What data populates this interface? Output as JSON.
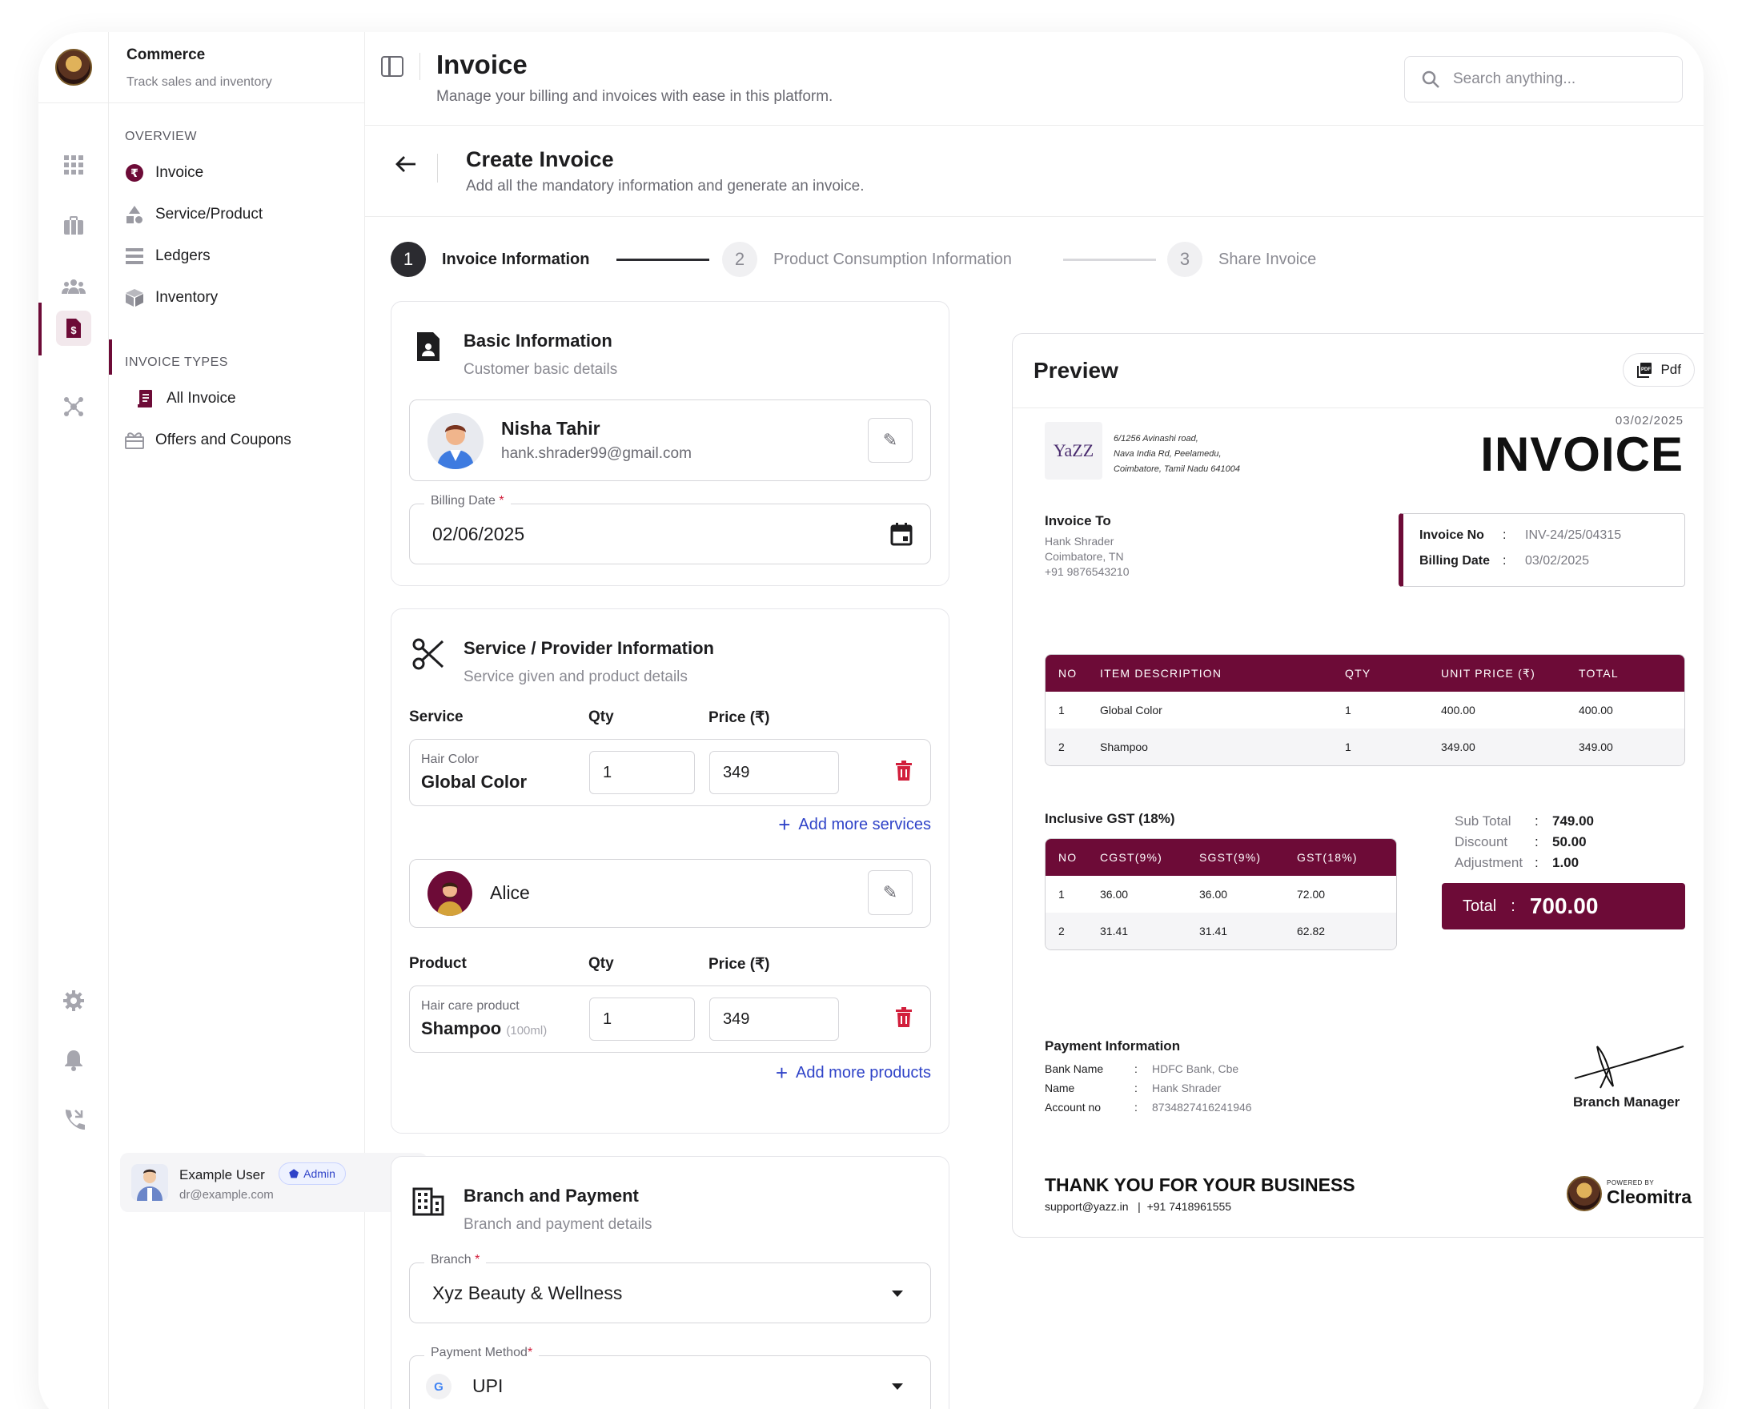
{
  "app": {
    "name": "Commerce",
    "tagline": "Track sales and inventory"
  },
  "rail": {
    "icons": [
      "dashboard-icon",
      "briefcase-icon",
      "users-icon",
      "invoice-icon",
      "network-icon",
      "settings-icon",
      "bell-icon",
      "phone-icon"
    ]
  },
  "sidebar": {
    "overview_label": "OVERVIEW",
    "overview_items": [
      {
        "label": "Invoice",
        "icon": "rupee-icon"
      },
      {
        "label": "Service/Product",
        "icon": "shapes-icon"
      },
      {
        "label": "Ledgers",
        "icon": "list-icon"
      },
      {
        "label": "Inventory",
        "icon": "box-icon"
      }
    ],
    "types_label": "INVOICE TYPES",
    "types_items": [
      {
        "label": "All Invoice",
        "icon": "receipt-icon"
      },
      {
        "label": "Offers and Coupons",
        "icon": "gift-icon"
      }
    ]
  },
  "user": {
    "name": "Example User",
    "email": "dr@example.com",
    "role": "Admin"
  },
  "header": {
    "title": "Invoice",
    "subtitle": "Manage your billing and invoices with ease in this platform.",
    "search_placeholder": "Search anything..."
  },
  "create": {
    "title": "Create Invoice",
    "subtitle": "Add all the mandatory information and generate an invoice."
  },
  "steps": [
    {
      "num": "1",
      "label": "Invoice Information",
      "active": true
    },
    {
      "num": "2",
      "label": "Product Consumption Information",
      "active": false
    },
    {
      "num": "3",
      "label": "Share Invoice",
      "active": false
    }
  ],
  "basic": {
    "title": "Basic Information",
    "subtitle": "Customer basic details",
    "customer_name": "Nisha Tahir",
    "customer_email": "hank.shrader99@gmail.com",
    "billing_date_label": "Billing Date",
    "billing_date": "02/06/2025"
  },
  "service": {
    "title": "Service / Provider Information",
    "subtitle": "Service given and product details",
    "col_service": "Service",
    "col_qty": "Qty",
    "col_price": "Price (₹)",
    "service_category": "Hair Color",
    "service_name": "Global Color",
    "service_qty": "1",
    "service_price": "349",
    "add_services": "Add more services",
    "provider_name": "Alice",
    "col_product": "Product",
    "product_category": "Hair care product",
    "product_name": "Shampoo",
    "product_size": "(100ml)",
    "product_qty": "1",
    "product_price": "349",
    "add_products": "Add more products"
  },
  "branch": {
    "title": "Branch and Payment",
    "subtitle": "Branch and payment details",
    "branch_label": "Branch",
    "branch_value": "Xyz Beauty & Wellness",
    "payment_label": "Payment Method",
    "payment_value": "UPI"
  },
  "preview": {
    "title": "Preview",
    "pdf_label": "Pdf",
    "logo_text": "YaZZ",
    "address": [
      "6/1256 Avinashi road,",
      "Nava India Rd, Peelamedu,",
      "Coimbatore, Tamil Nadu 641004"
    ],
    "date": "03/02/2025",
    "heading": "INVOICE",
    "invoice_to_label": "Invoice To",
    "invoice_to": [
      "Hank Shrader",
      "Coimbatore, TN",
      "+91 9876543210"
    ],
    "invoice_no_label": "Invoice No",
    "invoice_no": "INV-24/25/04315",
    "billing_date_label": "Billing Date",
    "billing_date": "03/02/2025",
    "items_header": [
      "NO",
      "ITEM DESCRIPTION",
      "QTY",
      "UNIT PRICE (₹)",
      "TOTAL"
    ],
    "items": [
      [
        "1",
        "Global Color",
        "1",
        "400.00",
        "400.00"
      ],
      [
        "2",
        "Shampoo",
        "1",
        "349.00",
        "349.00"
      ]
    ],
    "gst_title": "Inclusive GST (18%)",
    "gst_header": [
      "NO",
      "CGST(9%)",
      "SGST(9%)",
      "GST(18%)"
    ],
    "gst_rows": [
      [
        "1",
        "36.00",
        "36.00",
        "72.00"
      ],
      [
        "2",
        "31.41",
        "31.41",
        "62.82"
      ]
    ],
    "sub_total_label": "Sub Total",
    "sub_total": "749.00",
    "discount_label": "Discount",
    "discount": "50.00",
    "adjustment_label": "Adjustment",
    "adjustment": "1.00",
    "total_label": "Total",
    "total": "700.00",
    "payment_title": "Payment Information",
    "bank_name_label": "Bank Name",
    "bank_name": "HDFC Bank, Cbe",
    "name_label": "Name",
    "name": "Hank Shrader",
    "account_label": "Account no",
    "account": "8734827416241946",
    "signatory": "Branch Manager",
    "thanks": "THANK YOU FOR YOUR BUSINESS",
    "support_email": "support@yazz.in",
    "support_phone": "+91 7418961555",
    "powered_by": "POWERED BY",
    "brand": "Cleomitra"
  },
  "colors": {
    "accent": "#6d0b37",
    "link": "#2f43c8",
    "danger": "#d21f3c"
  }
}
